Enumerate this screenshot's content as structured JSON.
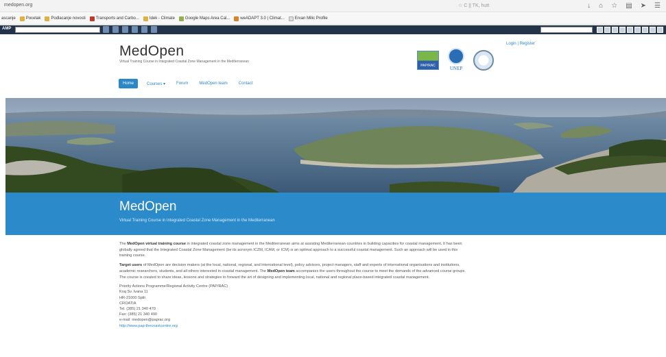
{
  "browser": {
    "url": "medopen.org",
    "nav_hint": "☆ C || TK, hutt",
    "bookmarks": [
      {
        "label": "ascanje"
      },
      {
        "label": "Pocetak"
      },
      {
        "label": "Podlacanje novosti"
      },
      {
        "label": "Transports and Carbo..."
      },
      {
        "label": "Idek - Climate"
      },
      {
        "label": "Google Maps Area Cal..."
      },
      {
        "label": "weADAPT 3.0 | Climat..."
      },
      {
        "label": "Ervan Milic Profile"
      }
    ],
    "toolbar_label": "AMP"
  },
  "header": {
    "title": "MedOpen",
    "subtitle": "Virtual Training Course in Integrated Coastal Zone Management in the Mediterranean",
    "login_text": "Login | Register",
    "logos": {
      "pap": "PAP/RAC",
      "unep": "UNEP"
    }
  },
  "menu": {
    "items": [
      {
        "label": "Home",
        "active": true
      },
      {
        "label": "Courses ▾",
        "active": false
      },
      {
        "label": "Forum",
        "active": false
      },
      {
        "label": "MedOpen team",
        "active": false
      },
      {
        "label": "Contact",
        "active": false
      }
    ]
  },
  "banner": {
    "title": "MedOpen",
    "subtitle": "Virtual Training Course in Integrated Coastal Zone Management in the Mediterranean"
  },
  "body": {
    "p1_strong": "MedOpen virtual training course",
    "p1_text": " in integrated coastal zone management in the Mediterranean aims at assisting Mediterranean countries in building capacities for coastal management. It has been globally agreed that the Integrated Coastal Zone Management (be its acronym ICZM, ICAM, or ICM) is an optimal approach to a successful coastal management. Such an approach will be used in this training course.",
    "p2_strong": "Target users",
    "p2_text": " of MedOpen are decision makers (at the local, national, regional, and international level), policy advisors, project managers, staff and experts of international organisations and institutions, academic researchers, students, and all others interested in coastal management. The ",
    "p2_strong2": "MedOpen team",
    "p2_text2": " accompanies the users throughout the course to meet the demands of the advanced course groups. The course is created to share ideas, lessons and strategies to forward the art of designing and implementing local, national and regional place-based integrated coastal management.",
    "address": {
      "org": "Priority Actions Programme/Regional Activity Centre (PAP/RAC)",
      "street": "Kraj Sv. Ivana 11",
      "city": "HR-21000 Split",
      "country": "CROATIA",
      "tel": "Tel. (385) 21 340 470",
      "fax": "Fax: (385) 21 340 490",
      "email": "e-mail: medopen@paprac.org",
      "website": "http://www.pap-thecoastcentre.org"
    }
  },
  "colors": {
    "accent": "#2a88c8",
    "band": "#2b8ac9",
    "chrome_dark": "#23344a"
  }
}
